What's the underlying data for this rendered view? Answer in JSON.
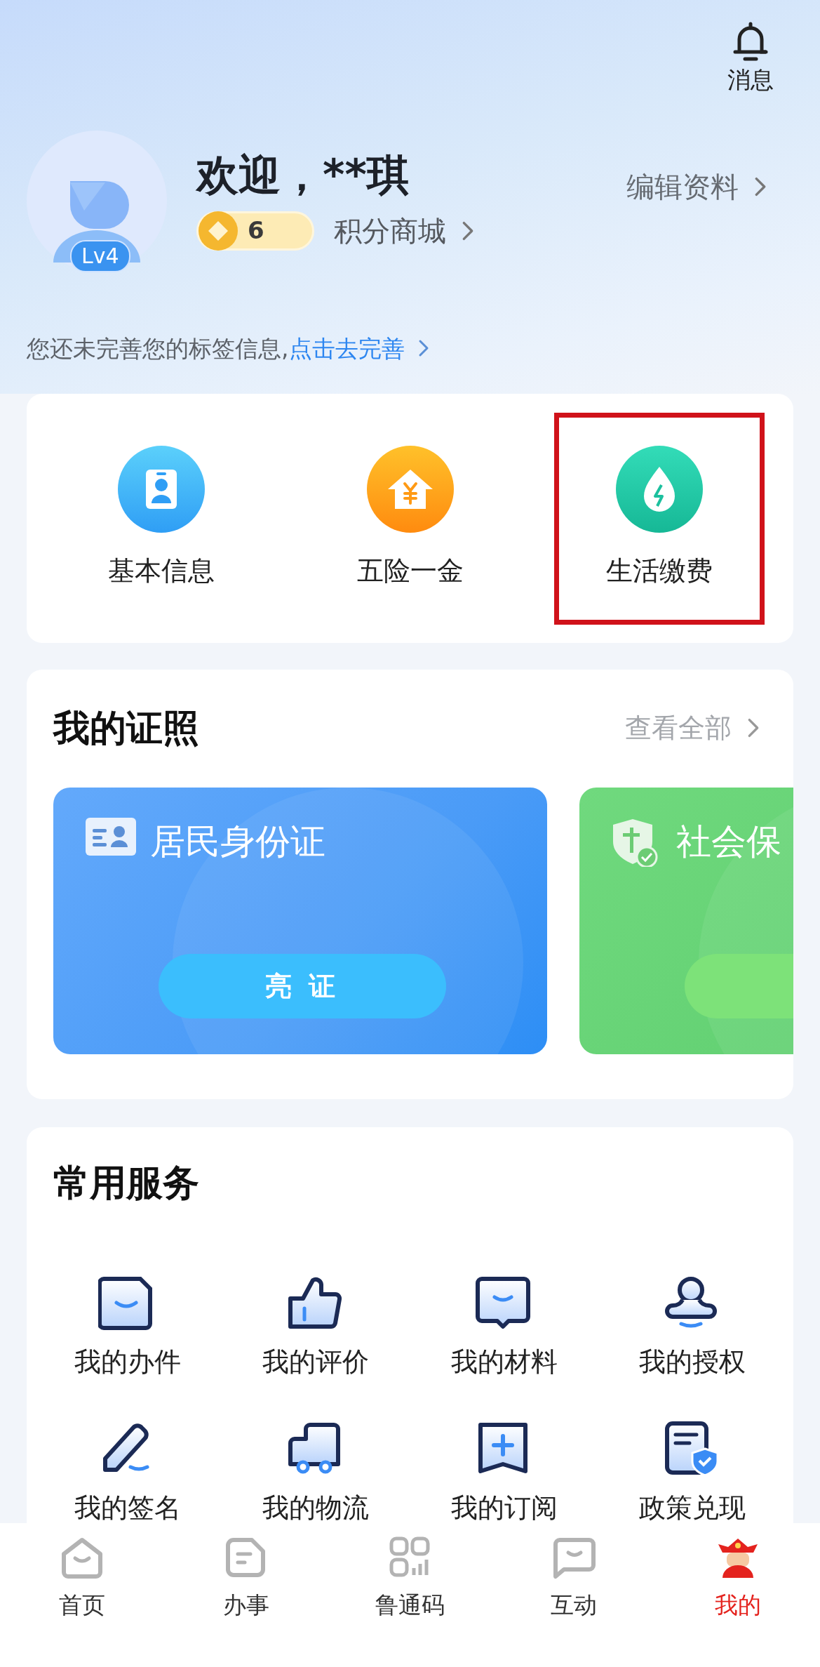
{
  "header": {
    "notification": {
      "label": "消息"
    },
    "profile": {
      "greeting": "欢迎，**琪",
      "level": "Lv4",
      "points": "6",
      "shop_link": "积分商城",
      "edit_link": "编辑资料"
    },
    "tag_prompt": {
      "text": "您还未完善您的标签信息,",
      "link": "点击去完善"
    }
  },
  "quick_actions": [
    {
      "label": "基本信息",
      "kind": "profile",
      "highlighted": false
    },
    {
      "label": "五险一金",
      "kind": "fund",
      "highlighted": false
    },
    {
      "label": "生活缴费",
      "kind": "bill",
      "highlighted": true
    }
  ],
  "licenses": {
    "title": "我的证照",
    "view_all": "查看全部",
    "cards": [
      {
        "title": "居民身份证",
        "kind": "id_card",
        "button": "亮证"
      },
      {
        "title": "社会保",
        "kind": "social_security"
      }
    ]
  },
  "services": {
    "title": "常用服务",
    "items": [
      {
        "label": "我的办件",
        "kind": "document"
      },
      {
        "label": "我的评价",
        "kind": "thumb"
      },
      {
        "label": "我的材料",
        "kind": "message"
      },
      {
        "label": "我的授权",
        "kind": "stamp"
      },
      {
        "label": "我的签名",
        "kind": "pen"
      },
      {
        "label": "我的物流",
        "kind": "truck"
      },
      {
        "label": "我的订阅",
        "kind": "bookmark"
      },
      {
        "label": "政策兑现",
        "kind": "policy"
      }
    ]
  },
  "tab_bar": [
    {
      "label": "首页",
      "kind": "home",
      "selected": false
    },
    {
      "label": "办事",
      "kind": "tasks",
      "selected": false
    },
    {
      "label": "鲁通码",
      "kind": "code",
      "selected": false
    },
    {
      "label": "互动",
      "kind": "chat",
      "selected": false
    },
    {
      "label": "我的",
      "kind": "mine",
      "selected": true
    }
  ]
}
